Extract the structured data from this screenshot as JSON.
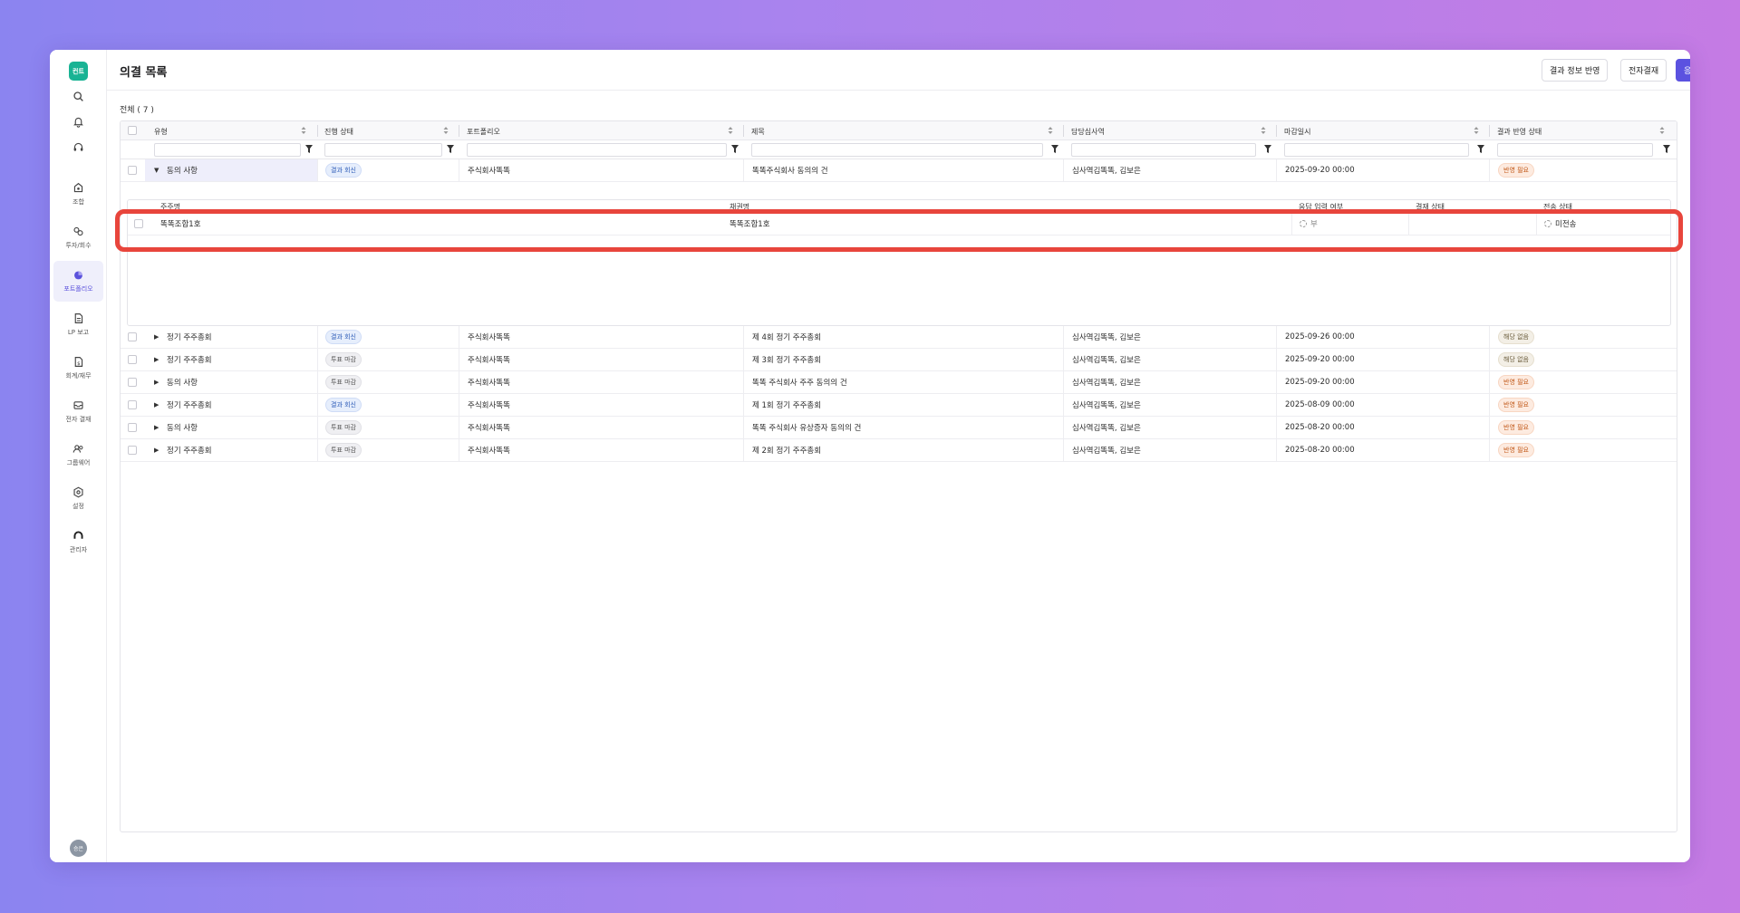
{
  "app": {
    "logo_text": "컨트",
    "page_title": "의결 목록",
    "avatar_text": "승은"
  },
  "sidebar": {
    "top_icons": [
      "search-icon",
      "bell-icon",
      "headset-icon"
    ],
    "items": [
      {
        "label": "조합",
        "icon": "union-icon",
        "active": false
      },
      {
        "label": "투자/회수",
        "icon": "investment-icon",
        "active": false
      },
      {
        "label": "포트폴리오",
        "icon": "portfolio-icon",
        "active": true
      },
      {
        "label": "LP 보고",
        "icon": "report-icon",
        "active": false
      },
      {
        "label": "회계/재무",
        "icon": "accounting-icon",
        "active": false
      },
      {
        "label": "전자 결재",
        "icon": "approval-icon",
        "active": false
      },
      {
        "label": "그룹웨어",
        "icon": "groupware-icon",
        "active": false
      },
      {
        "label": "설정",
        "icon": "settings-icon",
        "active": false
      },
      {
        "label": "관리자",
        "icon": "admin-icon",
        "active": false
      }
    ]
  },
  "header": {
    "buttons": {
      "apply_result": "결과 정보 반영",
      "e_approval": "전자결재",
      "send_response": "응답 전송"
    }
  },
  "list": {
    "count_label": "전체 ( 7 )",
    "columns": [
      "유형",
      "진행 상태",
      "포트폴리오",
      "제목",
      "담당심사역",
      "마감일시",
      "결과 반영 상태"
    ],
    "rows": [
      {
        "type": "동의 사항",
        "status": "결과 회신",
        "status_color": "blue",
        "portfolio": "주식회사똑똑",
        "title": "똑똑주식회사 동의의 건",
        "manager": "심사역김똑똑, 김보은",
        "deadline": "2025-09-20 00:00",
        "result": "반영 필요",
        "result_color": "orange",
        "expanded": true
      },
      {
        "type": "정기 주주총회",
        "status": "결과 회신",
        "status_color": "blue",
        "portfolio": "주식회사똑똑",
        "title": "제 4회 정기 주주총회",
        "manager": "심사역김똑똑, 김보은",
        "deadline": "2025-09-26 00:00",
        "result": "해당 없음",
        "result_color": "tan",
        "expanded": false
      },
      {
        "type": "정기 주주총회",
        "status": "투표 마감",
        "status_color": "gray",
        "portfolio": "주식회사똑똑",
        "title": "제 3회 정기 주주총회",
        "manager": "심사역김똑똑, 김보은",
        "deadline": "2025-09-20 00:00",
        "result": "해당 없음",
        "result_color": "tan",
        "expanded": false
      },
      {
        "type": "동의 사항",
        "status": "투표 마감",
        "status_color": "gray",
        "portfolio": "주식회사똑똑",
        "title": "똑똑 주식회사 주주 동의의 건",
        "manager": "심사역김똑똑, 김보은",
        "deadline": "2025-09-20 00:00",
        "result": "반영 필요",
        "result_color": "orange",
        "expanded": false
      },
      {
        "type": "정기 주주총회",
        "status": "결과 회신",
        "status_color": "blue",
        "portfolio": "주식회사똑똑",
        "title": "제 1회 정기 주주총회",
        "manager": "심사역김똑똑, 김보은",
        "deadline": "2025-08-09 00:00",
        "result": "반영 필요",
        "result_color": "orange",
        "expanded": false
      },
      {
        "type": "동의 사항",
        "status": "투표 마감",
        "status_color": "gray",
        "portfolio": "주식회사똑똑",
        "title": "똑똑 주식회사 유상증자 동의의 건",
        "manager": "심사역김똑똑, 김보은",
        "deadline": "2025-08-20 00:00",
        "result": "반영 필요",
        "result_color": "orange",
        "expanded": false
      },
      {
        "type": "정기 주주총회",
        "status": "투표 마감",
        "status_color": "gray",
        "portfolio": "주식회사똑똑",
        "title": "제 2회 정기 주주총회",
        "manager": "심사역김똑똑, 김보은",
        "deadline": "2025-08-20 00:00",
        "result": "반영 필요",
        "result_color": "orange",
        "expanded": false
      }
    ]
  },
  "sub_table": {
    "columns": [
      "주주명",
      "채권명",
      "응답 입력 여부",
      "결재 상태",
      "전송 상태"
    ],
    "row": {
      "shareholder": "똑똑조합1호",
      "bond": "똑똑조합1호",
      "response_entered": "부",
      "approval_status": "",
      "send_status": "미전송"
    }
  },
  "colors": {
    "primary": "#5b52e0",
    "logo": "#19b394",
    "highlight": "#e8453c",
    "active_nav": "#efeffb"
  }
}
